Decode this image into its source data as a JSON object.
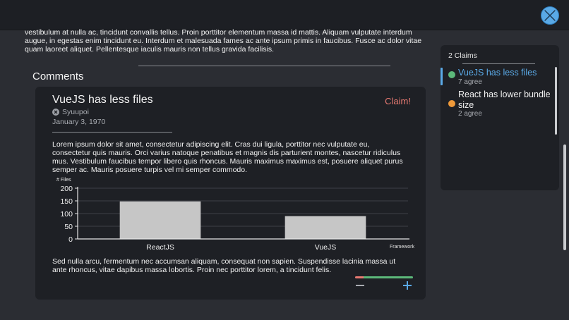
{
  "intro_text": "vestibulum at nulla ac, tincidunt convallis tellus. Proin porttitor elementum massa id mattis. Aliquam vulputate interdum augue, in egestas enim tincidunt eu. Interdum et malesuada fames ac ante ipsum primis in faucibus. Fusce ac dolor vitae quam laoreet aliquet. Pellentesque iaculis mauris non tellus gravida facilisis.",
  "comments_title": "Comments",
  "comment": {
    "title": "VueJS has less files",
    "claim_label": "Claim!",
    "author": "Syuupoi",
    "date": "January 3, 1970",
    "body": "Lorem ipsum dolor sit amet, consectetur adipiscing elit. Cras dui ligula, porttitor nec vulputate eu, consectetur quis mauris. Orci varius natoque penatibus et magnis dis parturient montes, nascetur ridiculus mus. Vestibulum faucibus tempor libero quis rhoncus. Mauris maximus maximus est, posuere aliquet purus semper ac. Mauris posuere turpis vel mi semper commodo.",
    "body2": "Sed nulla arcu, fermentum nec accumsan aliquam, consequat non sapien. Suspendisse lacinia massa ut ante rhoncus, vitae dapibus massa lobortis. Proin nec porttitor lorem, a tincidunt felis.",
    "vote": {
      "down_fraction": 0.15,
      "up_fraction": 0.85,
      "down_color": "#e87a72",
      "up_color": "#5cb87a",
      "down_icon": "minus-icon",
      "up_icon": "plus-icon"
    }
  },
  "chart_data": {
    "type": "bar",
    "categories": [
      "ReactJS",
      "VueJS"
    ],
    "values": [
      148,
      90
    ],
    "xlabel": "Framework",
    "ylabel": "# Files",
    "ylim": [
      0,
      200
    ],
    "yticks": [
      0,
      50,
      100,
      150,
      200
    ],
    "grid": true,
    "bar_color": "#c6c6c6"
  },
  "claims": {
    "count_label": "2 Claims",
    "items": [
      {
        "title": "VueJS has less files",
        "agree": "7 agree",
        "color": "#5cb87a",
        "active": true
      },
      {
        "title": "React has lower bundle size",
        "agree": "2 agree",
        "color": "#ef9a3a",
        "active": false
      }
    ]
  },
  "icons": {
    "close": "close-icon",
    "author": "user-icon"
  },
  "colors": {
    "accent": "#5aa9e6",
    "claim_link": "#e87a72"
  }
}
